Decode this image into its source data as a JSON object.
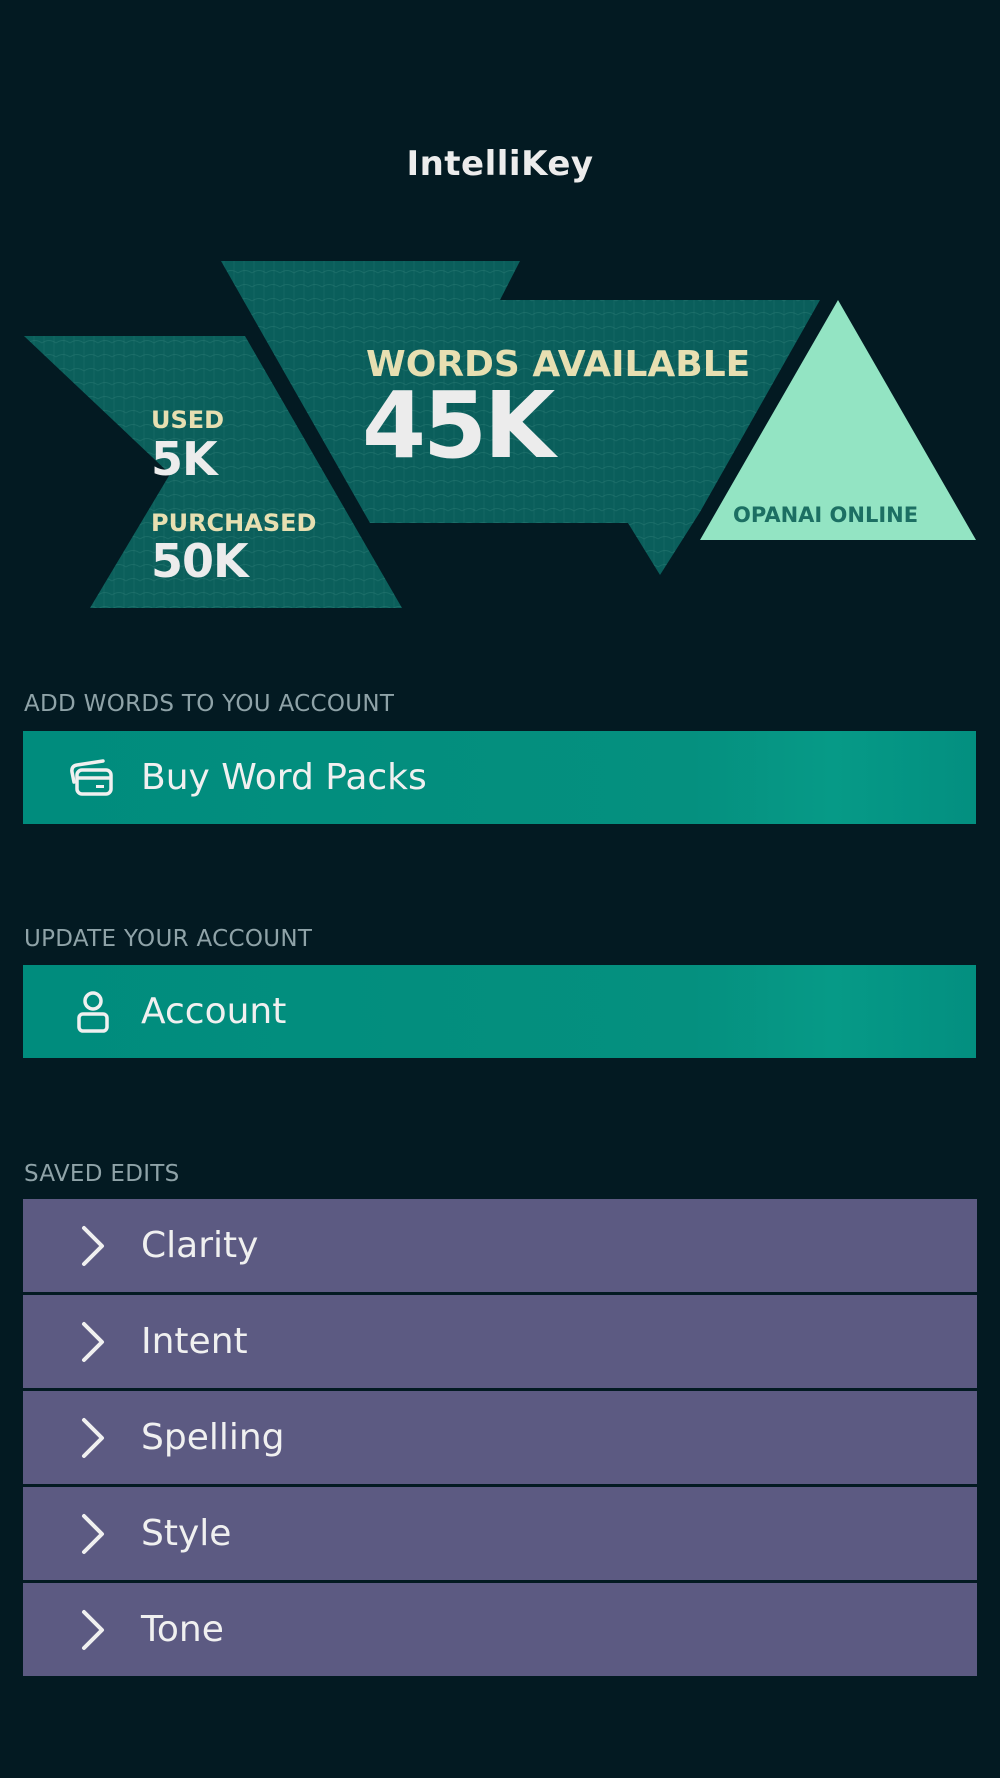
{
  "app": {
    "title": "IntelliKey"
  },
  "stats": {
    "used_label": "USED",
    "used_value": "5K",
    "purchased_label": "PURCHASED",
    "purchased_value": "50K",
    "available_label": "WORDS AVAILABLE",
    "available_value": "45K",
    "status": "OPANAI ONLINE"
  },
  "buy_section": {
    "label": "ADD WORDS TO YOU ACCOUNT",
    "button_label": "Buy Word Packs",
    "icon": "credit-cards-icon"
  },
  "account_section": {
    "label": "UPDATE YOUR ACCOUNT",
    "button_label": "Account",
    "icon": "user-icon"
  },
  "saved_edits": {
    "label": "SAVED EDITS",
    "items": [
      {
        "label": "Clarity",
        "icon": "chevron-right-icon"
      },
      {
        "label": "Intent",
        "icon": "chevron-right-icon"
      },
      {
        "label": "Spelling",
        "icon": "chevron-right-icon"
      },
      {
        "label": "Style",
        "icon": "chevron-right-icon"
      },
      {
        "label": "Tone",
        "icon": "chevron-right-icon"
      }
    ]
  },
  "colors": {
    "background": "#031a22",
    "banner_teal": "#0a5e5b",
    "status_triangle": "#93e4c3",
    "action_button": "#008c7d",
    "list_item": "#5c5a82",
    "accent_text": "#e7dfb1"
  }
}
